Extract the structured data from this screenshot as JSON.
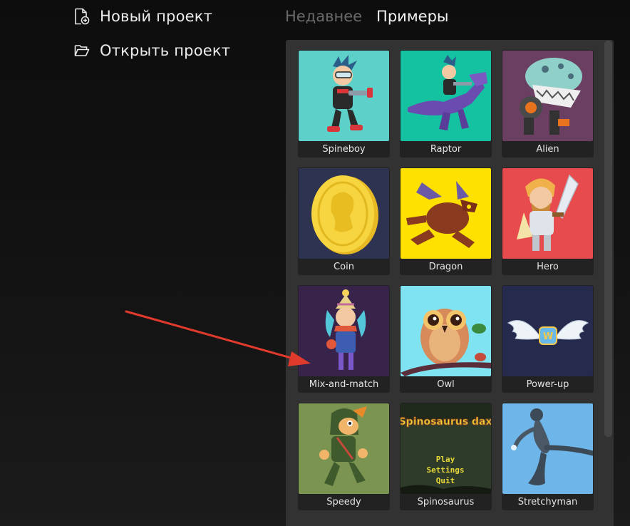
{
  "menu": {
    "new_project": "Новый проект",
    "open_project": "Открыть проект"
  },
  "tabs": [
    {
      "label": "Недавнее",
      "active": false
    },
    {
      "label": "Примеры",
      "active": true
    }
  ],
  "examples": [
    {
      "label": "Spineboy",
      "bg": "#5dd0c9"
    },
    {
      "label": "Raptor",
      "bg": "#14c2a2"
    },
    {
      "label": "Alien",
      "bg": "#6b3f61"
    },
    {
      "label": "Coin",
      "bg": "#2d3350"
    },
    {
      "label": "Dragon",
      "bg": "#ffe100"
    },
    {
      "label": "Hero",
      "bg": "#e84b4d"
    },
    {
      "label": "Mix-and-match",
      "bg": "#38244a"
    },
    {
      "label": "Owl",
      "bg": "#7fe3f2"
    },
    {
      "label": "Power-up",
      "bg": "#262a4c"
    },
    {
      "label": "Speedy",
      "bg": "#7b9451"
    },
    {
      "label": "Spinosaurus",
      "bg": "#2e3a2a",
      "title_text": "Spinosaurus dax",
      "menu": [
        "Play",
        "Settings",
        "Quit"
      ]
    },
    {
      "label": "Stretchyman",
      "bg": "#6eb6ea"
    }
  ],
  "colors": {
    "arrow": "#e03a2c",
    "panel": "#323232"
  }
}
